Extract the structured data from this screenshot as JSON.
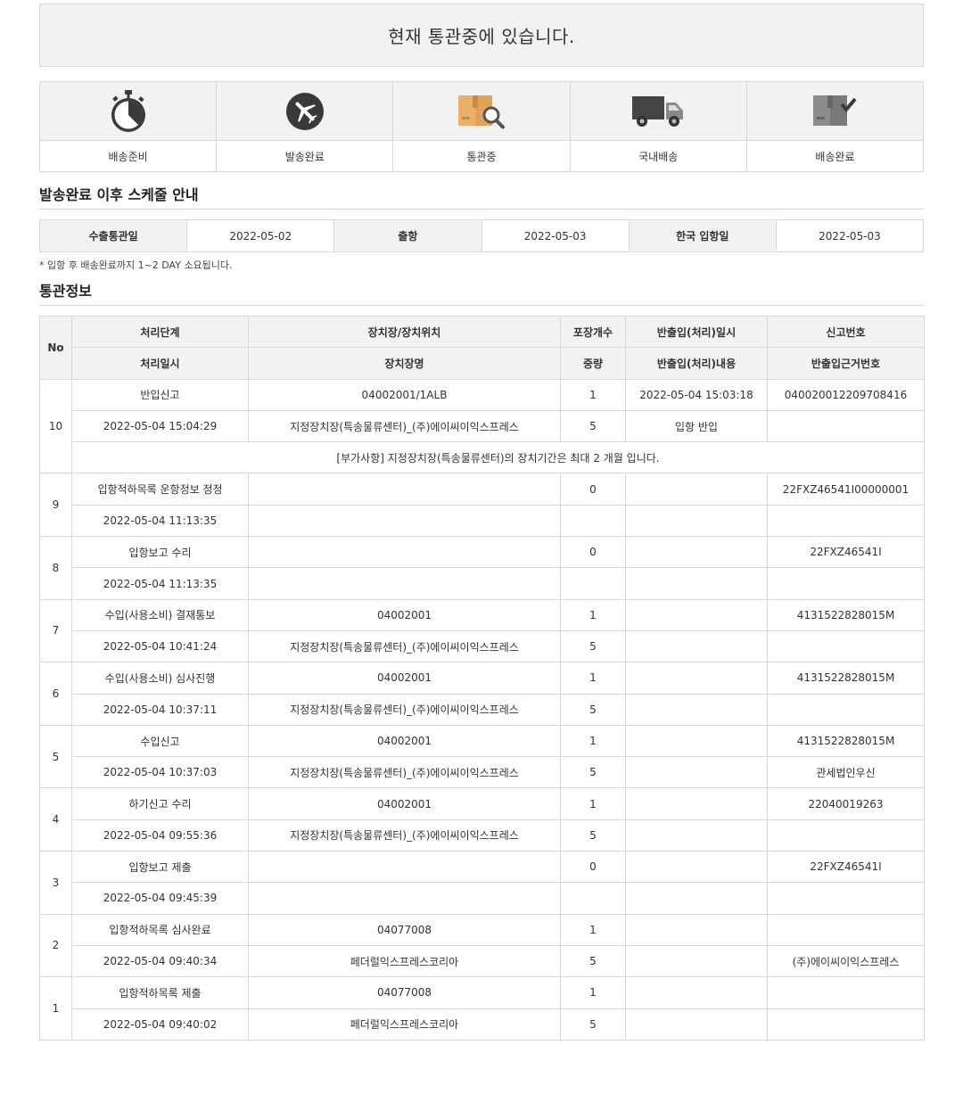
{
  "banner": {
    "status_text": "현재 통관중에 있습니다."
  },
  "steps": [
    {
      "label": "배송준비",
      "icon": "stopwatch-icon"
    },
    {
      "label": "발송완료",
      "icon": "airplane-icon"
    },
    {
      "label": "통관중",
      "icon": "box-search-icon"
    },
    {
      "label": "국내배송",
      "icon": "truck-icon"
    },
    {
      "label": "배송완료",
      "icon": "box-check-icon"
    }
  ],
  "schedule": {
    "title": "발송완료 이후 스케줄 안내",
    "export_label": "수출통관일",
    "export_date": "2022-05-02",
    "depart_label": "출항",
    "depart_date": "2022-05-03",
    "arrive_label": "한국 입항일",
    "arrive_date": "2022-05-03",
    "note": "* 입항 후 배송완료까지 1~2 DAY 소요됩니다."
  },
  "customs": {
    "title": "통관정보",
    "headers": {
      "no": "No",
      "stage": "처리단계",
      "location": "장치장/장치위치",
      "packages": "포장개수",
      "inout_datetime": "반출입(처리)일시",
      "report_no": "신고번호",
      "processed_at": "처리일시",
      "warehouse": "장치장명",
      "weight": "중량",
      "inout_detail": "반출입(처리)내용",
      "inout_basis": "반출입근거번호"
    },
    "rows": [
      {
        "no": "10",
        "stage": "반입신고",
        "location": "04002001/1ALB",
        "packages": "1",
        "inout_datetime": "2022-05-04 15:03:18",
        "report_no": "040020012209708416",
        "processed_at": "2022-05-04 15:04:29",
        "warehouse": "지정장치장(특송물류센터)_(주)에이씨이익스프레스",
        "weight": "5",
        "inout_detail": "입항 반입",
        "inout_basis": "",
        "extra": "[부가사항] 지정장치장(특송물류센터)의 장치기간은 최대 2 개월 입니다."
      },
      {
        "no": "9",
        "stage": "입항적하목록 운항정보 정정",
        "location": "",
        "packages": "0",
        "inout_datetime": "",
        "report_no": "22FXZ46541I00000001",
        "processed_at": "2022-05-04 11:13:35",
        "warehouse": "",
        "weight": "",
        "inout_detail": "",
        "inout_basis": ""
      },
      {
        "no": "8",
        "stage": "입항보고 수리",
        "location": "",
        "packages": "0",
        "inout_datetime": "",
        "report_no": "22FXZ46541I",
        "processed_at": "2022-05-04 11:13:35",
        "warehouse": "",
        "weight": "",
        "inout_detail": "",
        "inout_basis": ""
      },
      {
        "no": "7",
        "stage": "수입(사용소비) 결재통보",
        "location": "04002001",
        "packages": "1",
        "inout_datetime": "",
        "report_no": "4131522828015M",
        "processed_at": "2022-05-04 10:41:24",
        "warehouse": "지정장치장(특송물류센터)_(주)에이씨이익스프레스",
        "weight": "5",
        "inout_detail": "",
        "inout_basis": ""
      },
      {
        "no": "6",
        "stage": "수입(사용소비) 심사진행",
        "location": "04002001",
        "packages": "1",
        "inout_datetime": "",
        "report_no": "4131522828015M",
        "processed_at": "2022-05-04 10:37:11",
        "warehouse": "지정장치장(특송물류센터)_(주)에이씨이익스프레스",
        "weight": "5",
        "inout_detail": "",
        "inout_basis": ""
      },
      {
        "no": "5",
        "stage": "수입신고",
        "location": "04002001",
        "packages": "1",
        "inout_datetime": "",
        "report_no": "4131522828015M",
        "processed_at": "2022-05-04 10:37:03",
        "warehouse": "지정장치장(특송물류센터)_(주)에이씨이익스프레스",
        "weight": "5",
        "inout_detail": "",
        "inout_basis": "관세법인우신"
      },
      {
        "no": "4",
        "stage": "하기신고 수리",
        "location": "04002001",
        "packages": "1",
        "inout_datetime": "",
        "report_no": "22040019263",
        "processed_at": "2022-05-04 09:55:36",
        "warehouse": "지정장치장(특송물류센터)_(주)에이씨이익스프레스",
        "weight": "5",
        "inout_detail": "",
        "inout_basis": ""
      },
      {
        "no": "3",
        "stage": "입항보고 제출",
        "location": "",
        "packages": "0",
        "inout_datetime": "",
        "report_no": "22FXZ46541I",
        "processed_at": "2022-05-04 09:45:39",
        "warehouse": "",
        "weight": "",
        "inout_detail": "",
        "inout_basis": ""
      },
      {
        "no": "2",
        "stage": "입항적하목록 심사완료",
        "location": "04077008",
        "packages": "1",
        "inout_datetime": "",
        "report_no": "",
        "processed_at": "2022-05-04 09:40:34",
        "warehouse": "페더럴익스프레스코리아",
        "weight": "5",
        "inout_detail": "",
        "inout_basis": "(주)에이씨이익스프레스"
      },
      {
        "no": "1",
        "stage": "입항적하목록 제출",
        "location": "04077008",
        "packages": "1",
        "inout_datetime": "",
        "report_no": "",
        "processed_at": "2022-05-04 09:40:02",
        "warehouse": "페더럴익스프레스코리아",
        "weight": "5",
        "inout_detail": "",
        "inout_basis": ""
      }
    ]
  }
}
